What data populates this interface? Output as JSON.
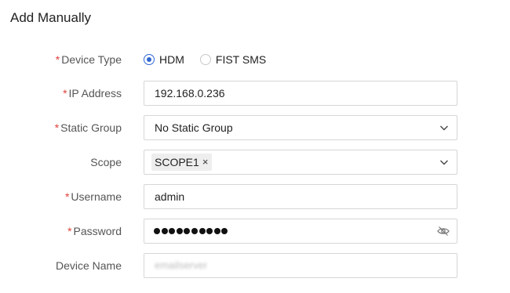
{
  "title": "Add Manually",
  "required_marker": "*",
  "form": {
    "device_type": {
      "label": "Device Type",
      "options": [
        {
          "label": "HDM",
          "checked": true
        },
        {
          "label": "FIST SMS",
          "checked": false
        }
      ]
    },
    "ip_address": {
      "label": "IP Address",
      "value": "192.168.0.236"
    },
    "static_group": {
      "label": "Static Group",
      "value": "No Static Group"
    },
    "scope": {
      "label": "Scope",
      "tags": [
        "SCOPE1"
      ],
      "tag_close": "×"
    },
    "username": {
      "label": "Username",
      "value": "admin"
    },
    "password": {
      "label": "Password",
      "masked_length": 10
    },
    "device_name": {
      "label": "Device Name",
      "value": "emailserver"
    }
  },
  "colors": {
    "accent": "#2e66d1",
    "required": "#e0403a",
    "border": "#d6d6d6"
  },
  "icons": {
    "select_arrow": "chevron-down-icon",
    "password_toggle": "eye-slash-icon"
  }
}
